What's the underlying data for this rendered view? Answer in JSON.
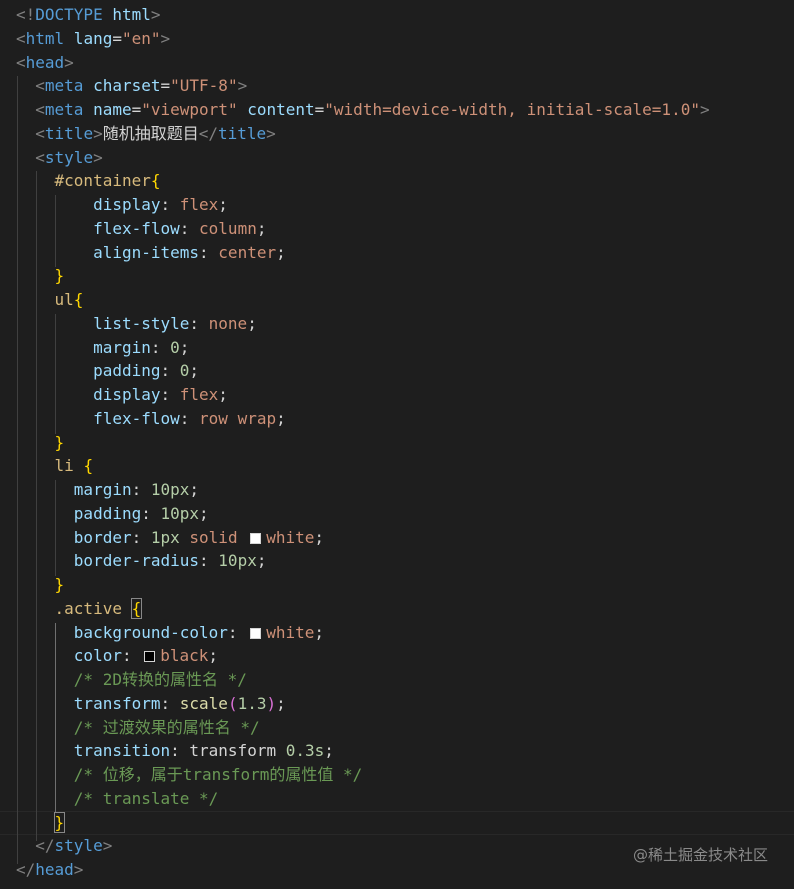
{
  "editor": {
    "background": "#1e1e1e",
    "lines": [
      [
        [
          "<!",
          "punc"
        ],
        [
          "DOCTYPE",
          "tag"
        ],
        [
          " html",
          "attr"
        ],
        [
          ">",
          "punc"
        ]
      ],
      [
        [
          "<",
          "punc"
        ],
        [
          "html",
          "tag"
        ],
        [
          " lang",
          "attr"
        ],
        [
          "=",
          "text"
        ],
        [
          "\"en\"",
          "str"
        ],
        [
          ">",
          "punc"
        ]
      ],
      [
        [
          "<",
          "punc"
        ],
        [
          "head",
          "tag"
        ],
        [
          ">",
          "punc"
        ]
      ],
      [
        [
          "  ",
          "text"
        ],
        [
          "<",
          "punc"
        ],
        [
          "meta",
          "tag"
        ],
        [
          " charset",
          "attr"
        ],
        [
          "=",
          "text"
        ],
        [
          "\"UTF-8\"",
          "str"
        ],
        [
          ">",
          "punc"
        ]
      ],
      [
        [
          "  ",
          "text"
        ],
        [
          "<",
          "punc"
        ],
        [
          "meta",
          "tag"
        ],
        [
          " name",
          "attr"
        ],
        [
          "=",
          "text"
        ],
        [
          "\"viewport\"",
          "str"
        ],
        [
          " content",
          "attr"
        ],
        [
          "=",
          "text"
        ],
        [
          "\"width=device-width, initial-scale=1.0\"",
          "str"
        ],
        [
          ">",
          "punc"
        ]
      ],
      [
        [
          "  ",
          "text"
        ],
        [
          "<",
          "punc"
        ],
        [
          "title",
          "tag"
        ],
        [
          ">",
          "punc"
        ],
        [
          "随机抽取题目",
          "text"
        ],
        [
          "</",
          "punc"
        ],
        [
          "title",
          "tag"
        ],
        [
          ">",
          "punc"
        ]
      ],
      [
        [
          "  ",
          "text"
        ],
        [
          "<",
          "punc"
        ],
        [
          "style",
          "tag"
        ],
        [
          ">",
          "punc"
        ]
      ],
      [
        [
          "    ",
          "text"
        ],
        [
          "#container",
          "sel"
        ],
        [
          "{",
          "brace1"
        ]
      ],
      [
        [
          "        ",
          "text"
        ],
        [
          "display",
          "prop"
        ],
        [
          ": ",
          "text"
        ],
        [
          "flex",
          "val"
        ],
        [
          ";",
          "text"
        ]
      ],
      [
        [
          "        ",
          "text"
        ],
        [
          "flex-flow",
          "prop"
        ],
        [
          ": ",
          "text"
        ],
        [
          "column",
          "val"
        ],
        [
          ";",
          "text"
        ]
      ],
      [
        [
          "        ",
          "text"
        ],
        [
          "align-items",
          "prop"
        ],
        [
          ": ",
          "text"
        ],
        [
          "center",
          "val"
        ],
        [
          ";",
          "text"
        ]
      ],
      [
        [
          "    ",
          "text"
        ],
        [
          "}",
          "brace1"
        ]
      ],
      [
        [
          "    ",
          "text"
        ],
        [
          "ul",
          "sel"
        ],
        [
          "{",
          "brace1"
        ]
      ],
      [
        [
          "        ",
          "text"
        ],
        [
          "list-style",
          "prop"
        ],
        [
          ": ",
          "text"
        ],
        [
          "none",
          "val"
        ],
        [
          ";",
          "text"
        ]
      ],
      [
        [
          "        ",
          "text"
        ],
        [
          "margin",
          "prop"
        ],
        [
          ": ",
          "text"
        ],
        [
          "0",
          "num"
        ],
        [
          ";",
          "text"
        ]
      ],
      [
        [
          "        ",
          "text"
        ],
        [
          "padding",
          "prop"
        ],
        [
          ": ",
          "text"
        ],
        [
          "0",
          "num"
        ],
        [
          ";",
          "text"
        ]
      ],
      [
        [
          "        ",
          "text"
        ],
        [
          "display",
          "prop"
        ],
        [
          ": ",
          "text"
        ],
        [
          "flex",
          "val"
        ],
        [
          ";",
          "text"
        ]
      ],
      [
        [
          "        ",
          "text"
        ],
        [
          "flex-flow",
          "prop"
        ],
        [
          ": ",
          "text"
        ],
        [
          "row wrap",
          "val"
        ],
        [
          ";",
          "text"
        ]
      ],
      [
        [
          "    ",
          "text"
        ],
        [
          "}",
          "brace1"
        ]
      ],
      [
        [
          "    ",
          "text"
        ],
        [
          "li",
          "sel"
        ],
        [
          " ",
          "text"
        ],
        [
          "{",
          "brace1"
        ]
      ],
      [
        [
          "      ",
          "text"
        ],
        [
          "margin",
          "prop"
        ],
        [
          ": ",
          "text"
        ],
        [
          "10px",
          "num"
        ],
        [
          ";",
          "text"
        ]
      ],
      [
        [
          "      ",
          "text"
        ],
        [
          "padding",
          "prop"
        ],
        [
          ": ",
          "text"
        ],
        [
          "10px",
          "num"
        ],
        [
          ";",
          "text"
        ]
      ],
      [
        [
          "      ",
          "text"
        ],
        [
          "border",
          "prop"
        ],
        [
          ": ",
          "text"
        ],
        [
          "1px",
          "num"
        ],
        [
          " ",
          "text"
        ],
        [
          "solid",
          "val"
        ],
        [
          " ",
          "text"
        ],
        [
          "#ffffff",
          "swatch"
        ],
        [
          "white",
          "val"
        ],
        [
          ";",
          "text"
        ]
      ],
      [
        [
          "      ",
          "text"
        ],
        [
          "border-radius",
          "prop"
        ],
        [
          ": ",
          "text"
        ],
        [
          "10px",
          "num"
        ],
        [
          ";",
          "text"
        ]
      ],
      [
        [
          "    ",
          "text"
        ],
        [
          "}",
          "brace1"
        ]
      ],
      [
        [
          "    ",
          "text"
        ],
        [
          ".active",
          "sel"
        ],
        [
          " ",
          "text"
        ],
        [
          "{",
          "brace1-match"
        ]
      ],
      [
        [
          "      ",
          "text"
        ],
        [
          "background-color",
          "prop"
        ],
        [
          ": ",
          "text"
        ],
        [
          "#ffffff",
          "swatch"
        ],
        [
          "white",
          "val"
        ],
        [
          ";",
          "text"
        ]
      ],
      [
        [
          "      ",
          "text"
        ],
        [
          "color",
          "prop"
        ],
        [
          ": ",
          "text"
        ],
        [
          "#000000",
          "swatch"
        ],
        [
          "black",
          "val"
        ],
        [
          ";",
          "text"
        ]
      ],
      [
        [
          "      ",
          "text"
        ],
        [
          "/* 2D转换的属性名 */",
          "comment"
        ]
      ],
      [
        [
          "      ",
          "text"
        ],
        [
          "transform",
          "prop"
        ],
        [
          ": ",
          "text"
        ],
        [
          "scale",
          "fn"
        ],
        [
          "(",
          "brace2"
        ],
        [
          "1.3",
          "num"
        ],
        [
          ")",
          "brace2"
        ],
        [
          ";",
          "text"
        ]
      ],
      [
        [
          "      ",
          "text"
        ],
        [
          "/* 过渡效果的属性名 */",
          "comment"
        ]
      ],
      [
        [
          "      ",
          "text"
        ],
        [
          "transition",
          "prop"
        ],
        [
          ": ",
          "text"
        ],
        [
          "transform",
          "text"
        ],
        [
          " ",
          "text"
        ],
        [
          "0.3s",
          "num"
        ],
        [
          ";",
          "text"
        ]
      ],
      [
        [
          "      ",
          "text"
        ],
        [
          "/* 位移，属于transform的属性值 */",
          "comment"
        ]
      ],
      [
        [
          "      ",
          "text"
        ],
        [
          "/* translate */",
          "comment"
        ]
      ],
      [
        [
          "    ",
          "text"
        ],
        [
          "}",
          "brace1-match"
        ]
      ],
      [
        [
          "  ",
          "text"
        ],
        [
          "</",
          "punc"
        ],
        [
          "style",
          "tag"
        ],
        [
          ">",
          "punc"
        ]
      ],
      [
        [
          "</",
          "punc"
        ],
        [
          "head",
          "tag"
        ],
        [
          ">",
          "punc"
        ]
      ]
    ]
  },
  "watermark": "@稀土掘金技术社区"
}
